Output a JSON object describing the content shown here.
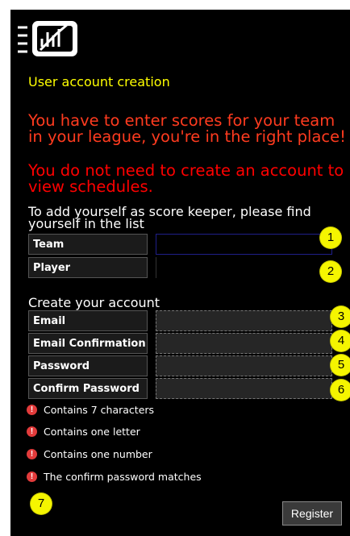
{
  "header": {
    "logo_icon": "menu-icon-with-chart-logo"
  },
  "title": "User account creation",
  "messages": {
    "scores": "You have to enter scores for your team in your league, you're in the right place!",
    "schedules": "You do not need to create an account to view schedules."
  },
  "find": {
    "instruction": "To add yourself as score keeper, please find yourself in the list",
    "fields": {
      "team": {
        "label": "Team",
        "value": ""
      },
      "player": {
        "label": "Player",
        "value": ""
      }
    }
  },
  "account": {
    "heading": "Create your account",
    "fields": {
      "email": {
        "label": "Email",
        "value": ""
      },
      "email_confirmation": {
        "label": "Email Confirmation",
        "value": ""
      },
      "password": {
        "label": "Password",
        "value": ""
      },
      "confirm_password": {
        "label": "Confirm Password",
        "value": ""
      }
    }
  },
  "rules": [
    {
      "icon": "exclamation-icon",
      "text": "Contains 7 characters"
    },
    {
      "icon": "exclamation-icon",
      "text": "Contains one letter"
    },
    {
      "icon": "exclamation-icon",
      "text": "Contains one number"
    },
    {
      "icon": "exclamation-icon",
      "text": "The confirm password matches"
    }
  ],
  "badges": [
    "1",
    "2",
    "3",
    "4",
    "5",
    "6",
    "7"
  ],
  "register_label": "Register",
  "colors": {
    "title": "#ffff00",
    "message": "#ff0000",
    "badge": "#f5f500",
    "warning": "#e23b3b",
    "background": "#000000"
  }
}
